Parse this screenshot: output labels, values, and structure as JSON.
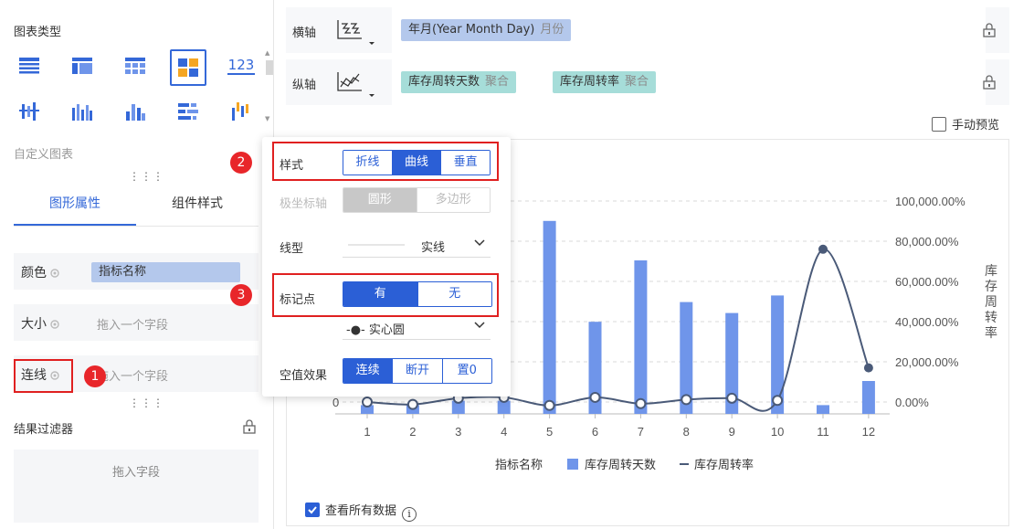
{
  "left": {
    "chart_type_title": "图表类型",
    "chart_type_123": "123",
    "custom_chart": "自定义图表",
    "tabs": [
      "图形属性",
      "组件样式"
    ],
    "props": [
      {
        "label": "颜色",
        "value": "指标名称"
      },
      {
        "label": "大小",
        "placeholder": "拖入一个字段"
      },
      {
        "label": "连线",
        "placeholder": "拖入一个字段"
      }
    ],
    "filter_title": "结果过滤器",
    "filter_placeholder": "拖入字段"
  },
  "badges": [
    "1",
    "2",
    "3"
  ],
  "axes": {
    "x": {
      "label": "横轴",
      "field": "年月(Year Month Day)",
      "sub": "月份"
    },
    "y": {
      "label": "纵轴",
      "fields": [
        {
          "name": "库存周转天数",
          "sub": "聚合"
        },
        {
          "name": "库存周转率",
          "sub": "聚合"
        }
      ]
    }
  },
  "manual_preview": "手动预览",
  "view_all_data": "查看所有数据",
  "info_glyph": "i",
  "popup": {
    "style": {
      "label": "样式",
      "options": [
        "折线",
        "曲线",
        "垂直"
      ],
      "selected": 1
    },
    "polar": {
      "label": "极坐标轴",
      "options": [
        "圆形",
        "多边形"
      ],
      "selected": 0
    },
    "line_type": {
      "label": "线型",
      "value": "实线"
    },
    "marker": {
      "label": "标记点",
      "options": [
        "有",
        "无"
      ],
      "selected": 0,
      "shape": "-●- 实心圆"
    },
    "null_effect": {
      "label": "空值效果",
      "options": [
        "连续",
        "断开",
        "置0"
      ],
      "selected": 0
    }
  },
  "colors": {
    "accent": "#2b5fd6",
    "bar": "#6f95ea",
    "line": "#4a5a78",
    "badge": "#e8262a"
  },
  "chart_data": {
    "type": "bar+line",
    "categories": [
      "1",
      "2",
      "3",
      "4",
      "5",
      "6",
      "7",
      "8",
      "9",
      "10",
      "11",
      "12"
    ],
    "left_zero_label": "0",
    "right_ticks": [
      "0.00%",
      "20,000.00%",
      "40,000.00%",
      "60,000.00%",
      "80,000.00%",
      "100,000.00%"
    ],
    "right_axis_label": "库存周转率",
    "legend_title": "指标名称",
    "series": [
      {
        "name": "库存周转天数",
        "type": "bar",
        "values": [
          4,
          4,
          6,
          6,
          88,
          42,
          70,
          51,
          46,
          54,
          4,
          15
        ]
      },
      {
        "name": "库存周转率",
        "type": "line",
        "smooth": true,
        "values": [
          0,
          -1200,
          1900,
          2300,
          -1700,
          2300,
          -800,
          1200,
          1900,
          800,
          76000,
          17000
        ]
      }
    ],
    "right_ylim": [
      0,
      100000
    ]
  }
}
